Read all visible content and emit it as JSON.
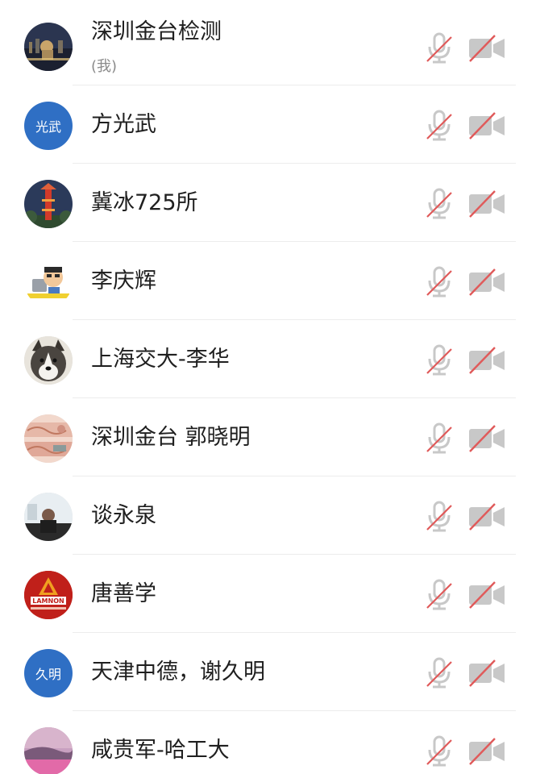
{
  "participants": [
    {
      "name": "深圳金台检测",
      "sub": "(我)",
      "avatar": "photo-night-city",
      "mic": "muted",
      "camera": "off"
    },
    {
      "name": "方光武",
      "avatar_text": "光武",
      "avatar": "initials",
      "mic": "muted",
      "camera": "off"
    },
    {
      "name": "冀冰725所",
      "avatar": "photo-red-tower",
      "mic": "muted",
      "camera": "off"
    },
    {
      "name": "李庆辉",
      "avatar": "cartoon-laptop",
      "mic": "muted",
      "camera": "off"
    },
    {
      "name": "上海交大-李华",
      "avatar": "photo-husky",
      "mic": "muted",
      "camera": "off"
    },
    {
      "name": "深圳金台 郭晓明",
      "avatar": "photo-banknote",
      "mic": "muted",
      "camera": "off"
    },
    {
      "name": "谈永泉",
      "avatar": "photo-person-room",
      "mic": "muted",
      "camera": "off"
    },
    {
      "name": "唐善学",
      "avatar": "logo-lamnon",
      "avatar_logo_text": "LAMNON",
      "mic": "muted",
      "camera": "off"
    },
    {
      "name": "天津中德，谢久明",
      "avatar_text": "久明",
      "avatar": "initials",
      "mic": "muted",
      "camera": "off"
    },
    {
      "name": "咸贵军-哈工大",
      "avatar": "photo-pink-sky",
      "mic": "muted",
      "camera": "off"
    }
  ],
  "icons": {
    "mic": "microphone-muted-icon",
    "camera": "camera-off-icon"
  },
  "colors": {
    "slash_red": "#e05a5a",
    "icon_gray": "#c8c8c8",
    "initials_blue": "#2f6fc4",
    "divider": "#ececec"
  }
}
